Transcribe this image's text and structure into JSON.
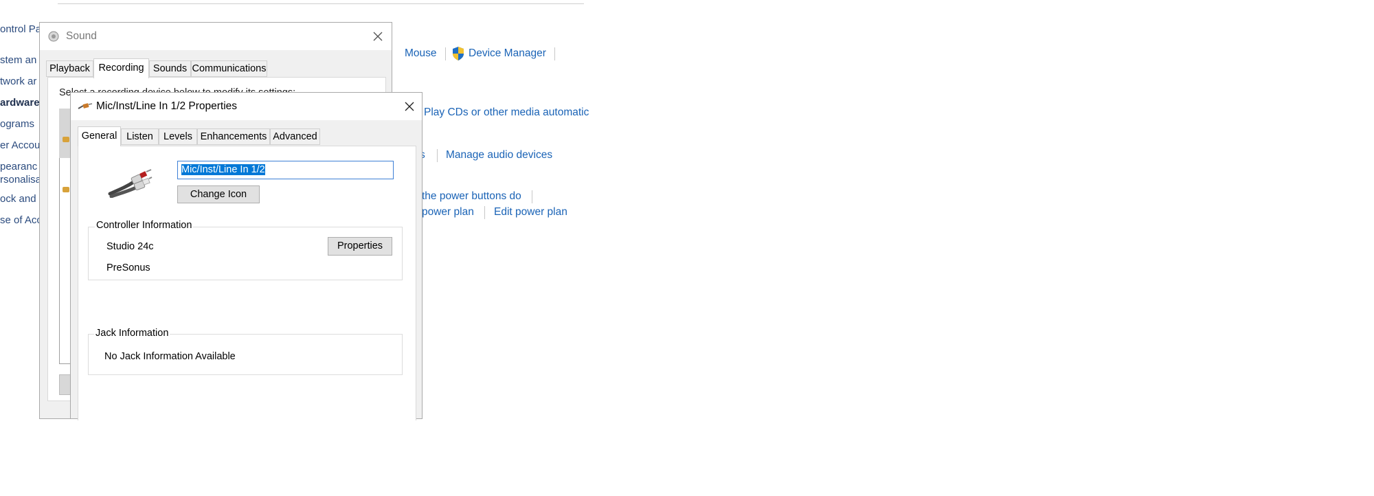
{
  "control_panel": {
    "sidebar": [
      "ontrol Pa",
      "stem an",
      "twork ar",
      "ardware",
      "ograms",
      "er Accou",
      "pearanc",
      "rsonalisa",
      "ock and",
      "se of Acc"
    ],
    "links": {
      "mouse": "Mouse",
      "device_manager": "Device Manager",
      "autoplay": "Play CDs or other media automatic",
      "s_fragment": "s",
      "manage_audio": "Manage audio devices",
      "power_buttons": "the power buttons do",
      "power_plan": "power plan",
      "edit_power_plan": "Edit power plan"
    }
  },
  "sound_window": {
    "title": "Sound",
    "icon": "speaker-icon",
    "tabs": [
      "Playback",
      "Recording",
      "Sounds",
      "Communications"
    ],
    "active_tab": "Recording",
    "hint": "Select a recording device below to modify its settings:"
  },
  "props_window": {
    "title": "Mic/Inst/Line In 1/2 Properties",
    "icon": "rca-cable-icon",
    "tabs": [
      "General",
      "Listen",
      "Levels",
      "Enhancements",
      "Advanced"
    ],
    "active_tab": "General",
    "device_name_value": "Mic/Inst/Line In 1/2",
    "change_icon_label": "Change Icon",
    "controller": {
      "title": "Controller Information",
      "name": "Studio 24c",
      "vendor": "PreSonus",
      "properties_label": "Properties"
    },
    "jack": {
      "title": "Jack Information",
      "text": "No Jack Information Available"
    }
  }
}
